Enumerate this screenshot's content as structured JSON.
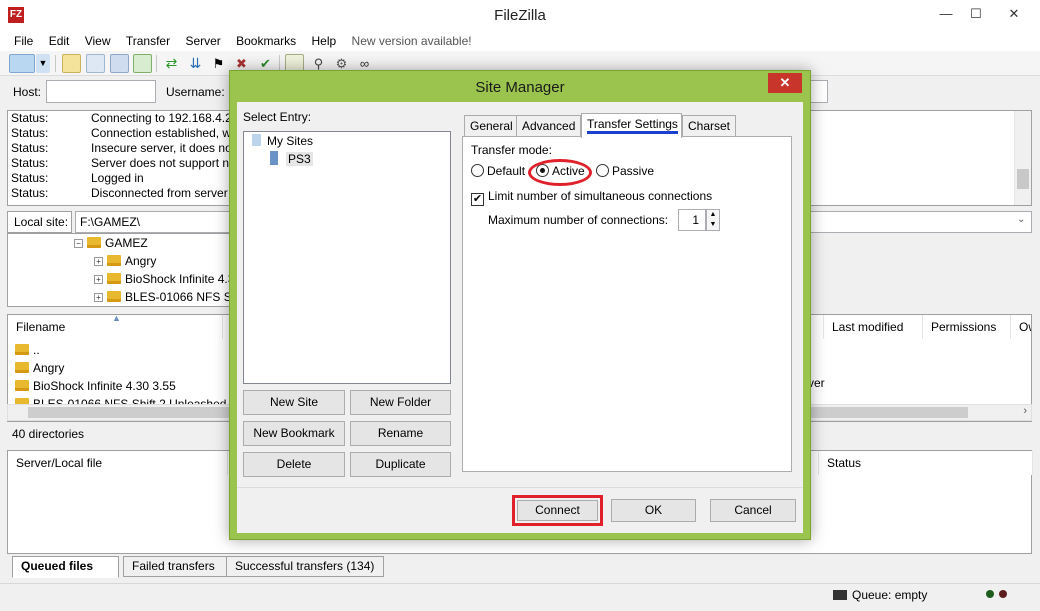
{
  "app": {
    "title": "FileZilla",
    "icon_text": "FZ"
  },
  "window_controls": {
    "minimize": "—",
    "maximize": "☐",
    "close": "✕"
  },
  "menu": [
    "File",
    "Edit",
    "View",
    "Transfer",
    "Server",
    "Bookmarks",
    "Help",
    "New version available!"
  ],
  "quickconnect": {
    "host_label": "Host:",
    "username_label": "Username:",
    "host_value": ""
  },
  "log": [
    {
      "k": "Status:",
      "v": "Connecting to 192.168.4.24"
    },
    {
      "k": "Status:",
      "v": "Connection established, w"
    },
    {
      "k": "Status:",
      "v": "Insecure server, it does not"
    },
    {
      "k": "Status:",
      "v": "Server does not support no"
    },
    {
      "k": "Status:",
      "v": "Logged in"
    },
    {
      "k": "Status:",
      "v": "Disconnected from server"
    }
  ],
  "local": {
    "label": "Local site:",
    "path": "F:\\GAMEZ\\",
    "tree": [
      {
        "label": "GAMEZ",
        "level": 0,
        "exp": "−"
      },
      {
        "label": "Angry",
        "level": 1,
        "exp": "+"
      },
      {
        "label": "BioShock Infinite 4.3",
        "level": 1,
        "exp": "+"
      },
      {
        "label": "BLES-01066 NFS Sh",
        "level": 1,
        "exp": "+"
      }
    ],
    "columns": {
      "filename": "Filename",
      "last_modified": "Last modified",
      "permissions": "Permissions",
      "owner": "Ow"
    },
    "files": [
      "..",
      "Angry",
      "BioShock Infinite 4.30 3.55",
      "BLES-01066 NFS Shift 2 Unleashed"
    ],
    "right_fragment": "rver",
    "dir_count": "40 directories"
  },
  "queue": {
    "col_server_local": "Server/Local file",
    "col_status": "Status"
  },
  "bottom_tabs": [
    "Queued files",
    "Failed transfers",
    "Successful transfers (134)"
  ],
  "statusbar": {
    "queue": "Queue: empty"
  },
  "dialog": {
    "title": "Site Manager",
    "close": "✕",
    "select_entry_label": "Select Entry:",
    "tree": {
      "root": "My Sites",
      "child": "PS3"
    },
    "buttons": {
      "new_site": "New Site",
      "new_folder": "New Folder",
      "new_bookmark": "New Bookmark",
      "rename": "Rename",
      "delete": "Delete",
      "duplicate": "Duplicate",
      "connect": "Connect",
      "ok": "OK",
      "cancel": "Cancel"
    },
    "tabs": [
      "General",
      "Advanced",
      "Transfer Settings",
      "Charset"
    ],
    "active_tab": "Transfer Settings",
    "transfer": {
      "mode_label": "Transfer mode:",
      "modes": [
        "Default",
        "Active",
        "Passive"
      ],
      "selected_mode": "Active",
      "limit_label": "Limit number of simultaneous connections",
      "limit_checked": true,
      "max_label": "Maximum number of connections:",
      "max_value": "1"
    }
  },
  "colors": {
    "dialog_frame": "#9ac44e",
    "highlight": "#e0202a",
    "tab_underline": "#1a3fd1",
    "close_red": "#c7352b"
  }
}
